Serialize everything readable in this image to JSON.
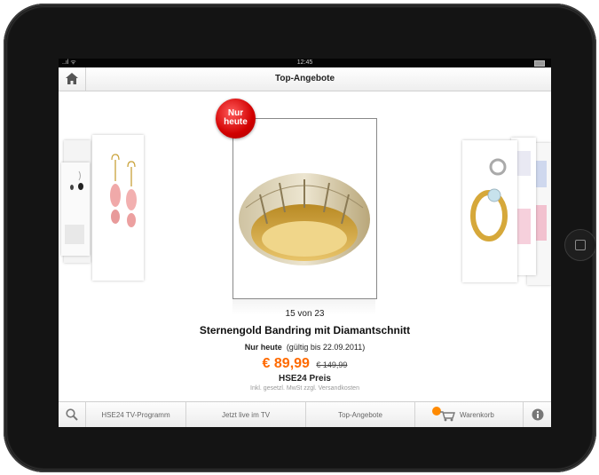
{
  "status_bar": {
    "signal": "..ıl ᯤ",
    "time": "12:45"
  },
  "nav": {
    "title": "Top-Angebote"
  },
  "product": {
    "badge_line1": "Nur",
    "badge_line2": "heute",
    "position": "15 von 23",
    "title": "Sternengold Bandring mit Diamantschnitt",
    "offer_label": "Nur heute",
    "offer_valid": "(gültig bis 22.09.2011)",
    "price": "€ 89,99",
    "old_price": "€ 149,99",
    "price_label": "HSE24 Preis",
    "tax_note": "Inkl. gesetzl. MwSt zzgl. Versandkosten"
  },
  "tabs": {
    "tv_programm": "HSE24 TV-Programm",
    "live": "Jetzt live im TV",
    "top_angebote": "Top-Angebote",
    "warenkorb": "Warenkorb"
  },
  "colors": {
    "accent": "#ff6a00",
    "badge_red": "#d10000",
    "cart_badge": "#ff8a00"
  },
  "icons": [
    "home-icon",
    "search-icon",
    "cart-icon",
    "info-icon",
    "battery-icon"
  ]
}
